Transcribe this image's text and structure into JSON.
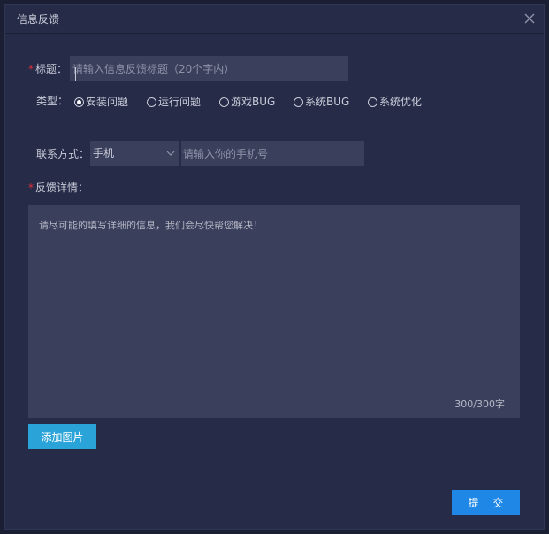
{
  "dialog": {
    "title": "信息反馈",
    "close_icon": "close-icon"
  },
  "form": {
    "required_mark": "*",
    "title_label": "标题：",
    "title_placeholder": "请输入信息反馈标题（20个字内）",
    "type_label": "类型：",
    "types": [
      {
        "label": "安装问题",
        "checked": true
      },
      {
        "label": "运行问题",
        "checked": false
      },
      {
        "label": "游戏BUG",
        "checked": false
      },
      {
        "label": "系统BUG",
        "checked": false
      },
      {
        "label": "系统优化",
        "checked": false
      }
    ],
    "contact_label": "联系方式：",
    "contact_method": "手机",
    "contact_chevron_icon": "chevron-down-icon",
    "phone_placeholder": "请输入你的手机号",
    "detail_label": "反馈详情：",
    "detail_placeholder": "请尽可能的填写详细的信息，我们会尽快帮您解决！",
    "char_counter": "300/300字",
    "add_image_label": "添加图片",
    "submit_label": "提 交"
  },
  "colors": {
    "background": "#262b48",
    "input_bg": "#3a3f5c",
    "required": "#e0303a",
    "add_button": "#2aa3d8",
    "submit_button": "#1f87e6"
  }
}
